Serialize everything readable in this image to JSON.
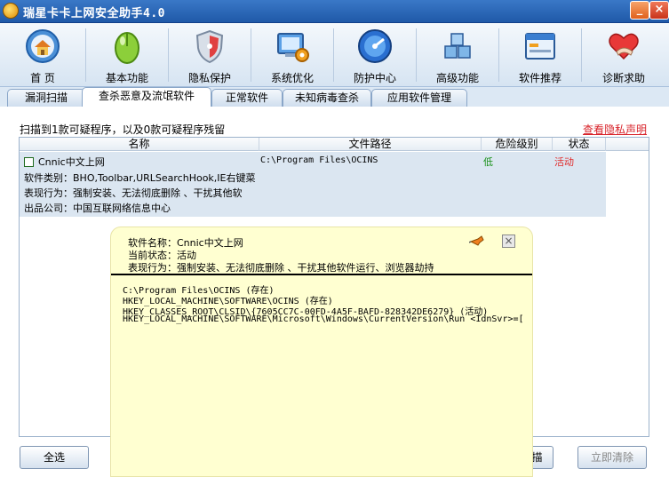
{
  "window": {
    "title": "瑞星卡卡上网安全助手4.0",
    "minimize_label": "_",
    "close_label": "×"
  },
  "toolbar": {
    "items": [
      {
        "label": "首 页",
        "icon": "home-icon"
      },
      {
        "label": "基本功能",
        "icon": "mouse-icon"
      },
      {
        "label": "隐私保护",
        "icon": "privacy-shield-icon"
      },
      {
        "label": "系统优化",
        "icon": "system-optimize-icon"
      },
      {
        "label": "防护中心",
        "icon": "protection-icon"
      },
      {
        "label": "高级功能",
        "icon": "cubes-icon"
      },
      {
        "label": "软件推荐",
        "icon": "software-window-icon"
      },
      {
        "label": "诊断求助",
        "icon": "help-heart-icon"
      }
    ]
  },
  "tabs": [
    {
      "label": "漏洞扫描"
    },
    {
      "label": "查杀恶意及流氓软件",
      "active": true
    },
    {
      "label": "正常软件"
    },
    {
      "label": "未知病毒查杀"
    },
    {
      "label": "应用软件管理"
    }
  ],
  "summary": {
    "scan_text": "扫描到1款可疑程序，以及0款可疑程序残留",
    "privacy_link": "查看隐私声明"
  },
  "table": {
    "columns": [
      "名称",
      "文件路径",
      "危险级别",
      "状态"
    ],
    "rows": [
      {
        "name": "Cnnic中文上网",
        "path": "C:\\Program Files\\OCINS",
        "level": "低",
        "status": "活动",
        "category": "软件类别：BHO,Toolbar,URLSearchHook,IE右键菜",
        "behavior": "表现行为：强制安装、无法彻底删除 、干扰其他软",
        "company": "出品公司：中国互联网络信息中心"
      }
    ]
  },
  "buttons": {
    "select_all": "全选",
    "scan_partial": "描",
    "clean_now": "立即清除"
  },
  "popup": {
    "software_name": "软件名称：Cnnic中文上网",
    "current_status": "当前状态：活动",
    "behavior": "表现行为：强制安装、无法彻底删除 、干扰其他软件运行、浏览器劫持",
    "close_label": "×",
    "paths": [
      "C:\\Program Files\\OCINS  (存在)",
      "HKEY_LOCAL_MACHINE\\SOFTWARE\\OCINS (存在)",
      "HKEY_CLASSES_ROOT\\CLSID\\{7605CC7C-00FD-4A5F-BAFD-828342DE6279} (活动)",
      "HKEY_LOCAL_MACHINE\\SOFTWARE\\Microsoft\\Windows\\CurrentVersion\\Run <IdnSvr>=["
    ]
  },
  "colors": {
    "title_bar": "#2a66b8",
    "link_red": "#d8232a",
    "level_green": "#189018",
    "status_red": "#e02a2a",
    "popup_bg": "#ffffd1",
    "row_selected": "#dbe6f1"
  }
}
